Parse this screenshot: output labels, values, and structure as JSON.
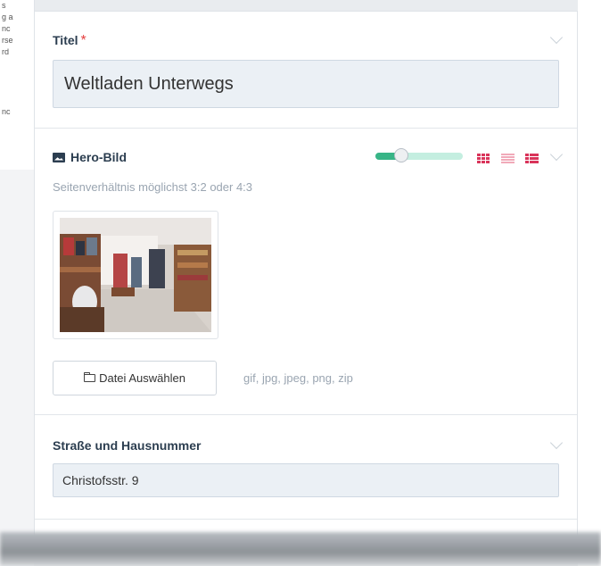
{
  "left_fragment_lines": [
    "s",
    "g a",
    "nc",
    "rse",
    "rd",
    "nc"
  ],
  "title_field": {
    "label": "Titel",
    "required_mark": "*",
    "value": "Weltladen Unterwegs"
  },
  "hero_field": {
    "label": "Hero-Bild",
    "hint": "Seitenverhältnis möglichst 3:2 oder 4:3",
    "slider_level": 0.3,
    "choose_file_label": "Datei Auswählen",
    "allowed_types": "gif, jpg, jpeg, png, zip"
  },
  "street_field": {
    "label": "Straße und Hausnummer",
    "value": "Christofsstr. 9"
  },
  "colors": {
    "required": "#e53e3e",
    "slider_fill": "#38b587",
    "layout_icon_active": "#d9345a"
  }
}
